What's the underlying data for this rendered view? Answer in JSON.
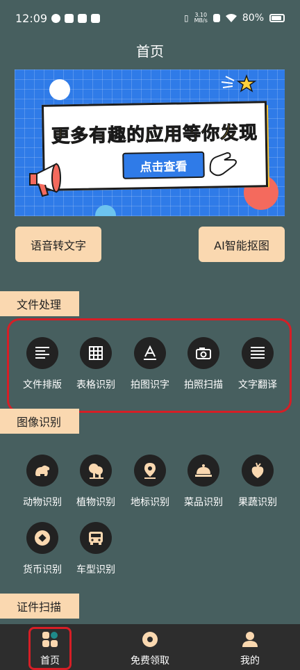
{
  "status_bar": {
    "time": "12:09",
    "net_speed_value": "3.10",
    "net_speed_unit": "MB/s",
    "battery": "80%"
  },
  "header": {
    "title": "首页"
  },
  "banner": {
    "headline": "更多有趣的应用等你发现",
    "button_label": "点击查看"
  },
  "quick_actions": {
    "left_label": "语音转文字",
    "right_label": "AI智能抠图"
  },
  "sections": {
    "document": {
      "title": "文件处理",
      "items": [
        {
          "label": "文件排版",
          "icon": "align-lines-icon"
        },
        {
          "label": "表格识别",
          "icon": "table-icon"
        },
        {
          "label": "拍图识字",
          "icon": "text-a-icon"
        },
        {
          "label": "拍照扫描",
          "icon": "camera-icon"
        },
        {
          "label": "文字翻译",
          "icon": "translate-lines-icon"
        }
      ]
    },
    "image": {
      "title": "图像识别",
      "items": [
        {
          "label": "动物识别",
          "icon": "animal-icon"
        },
        {
          "label": "植物识别",
          "icon": "tree-icon"
        },
        {
          "label": "地标识别",
          "icon": "location-pin-icon"
        },
        {
          "label": "菜品识别",
          "icon": "dish-cloche-icon"
        },
        {
          "label": "果蔬识别",
          "icon": "fruit-icon"
        },
        {
          "label": "货币识别",
          "icon": "coin-icon"
        },
        {
          "label": "车型识别",
          "icon": "car-icon"
        }
      ]
    },
    "id": {
      "title": "证件扫描"
    }
  },
  "tabbar": {
    "home": "首页",
    "free": "免费领取",
    "mine": "我的"
  },
  "colors": {
    "background": "#475f5f",
    "accent_peach": "#fad8b0",
    "highlight_red": "#d61e26",
    "icon_circle": "#222222",
    "tabbar": "#2d2d2d"
  }
}
